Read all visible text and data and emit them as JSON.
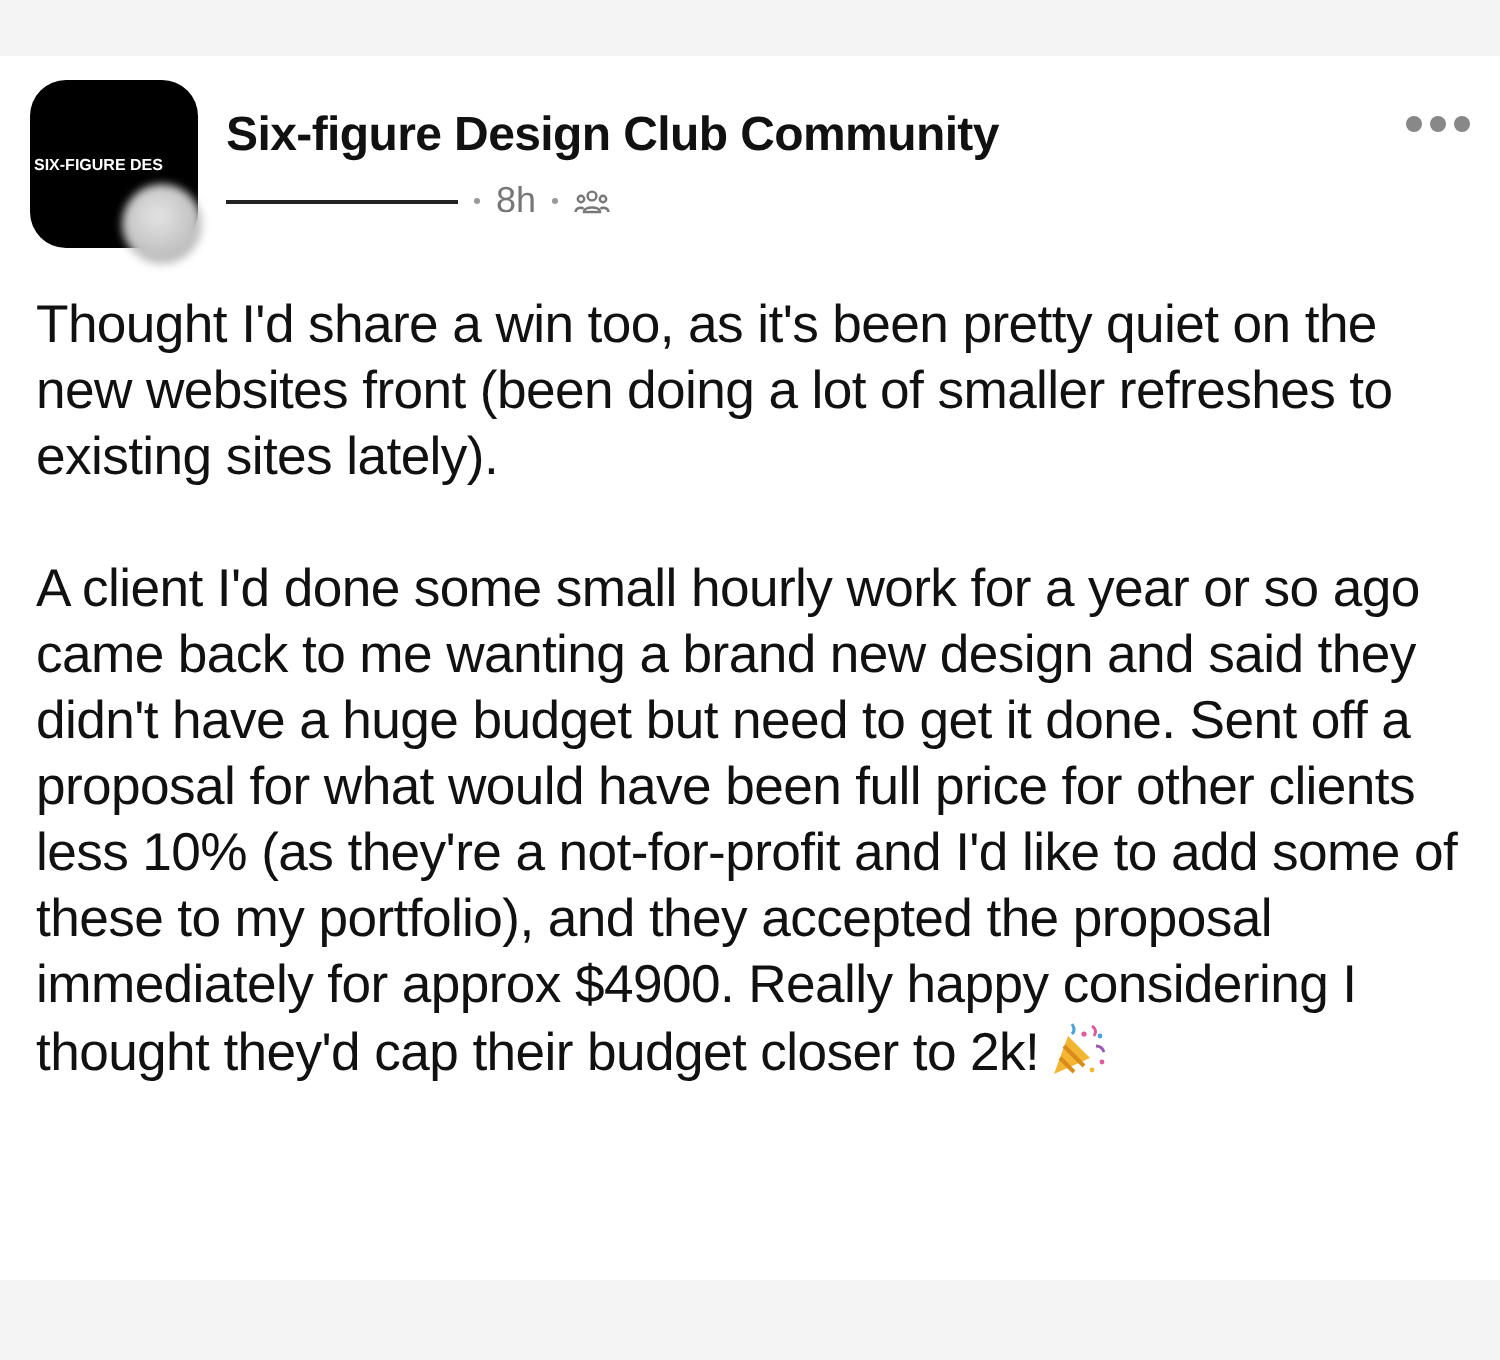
{
  "post": {
    "group_logo_text": "SIX-FIGURE DES",
    "group_name": "Six-figure Design Club Community",
    "time": "8h",
    "paragraphs": [
      "Thought I'd share a win too, as it's been pretty quiet on the new websites front (been doing a lot of smaller refreshes to existing sites lately).",
      "A client I'd done some small hourly work for a year or so ago came back to me wanting a brand new design and said they didn't have a huge budget but need to get it done. Sent off a proposal for what would have been full price for other clients less 10% (as they're a not-for-profit and I'd like to add some of these to my portfolio), and they accepted the proposal immediately for approx $4900. Really happy considering I thought they'd cap their budget closer to 2k!"
    ]
  }
}
